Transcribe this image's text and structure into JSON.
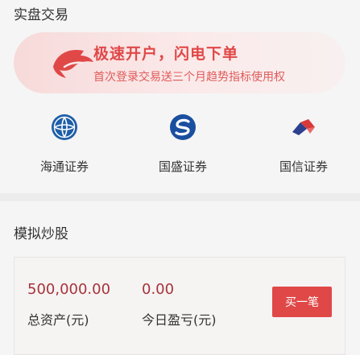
{
  "sections": {
    "real_trading_title": "实盘交易",
    "simulated_title": "模拟炒股"
  },
  "promo": {
    "title": "极速开户，闪电下单",
    "subtitle": "首次登录交易送三个月趋势指标使用权",
    "logo_icon": "shark-icon",
    "accent_color": "#e04848"
  },
  "brokers": [
    {
      "name": "海通证券",
      "icon": "haitong-logo-icon",
      "color": "#1e5ea8"
    },
    {
      "name": "国盛证券",
      "icon": "guosheng-logo-icon",
      "color": "#1a4fa0"
    },
    {
      "name": "国信证券",
      "icon": "guosen-logo-icon",
      "color": "#d83a3a"
    }
  ],
  "simulated": {
    "total_assets_value": "500,000.00",
    "total_assets_label": "总资产(元)",
    "today_pnl_value": "0.00",
    "today_pnl_label": "今日盈亏(元)",
    "buy_button_label": "买一笔"
  }
}
